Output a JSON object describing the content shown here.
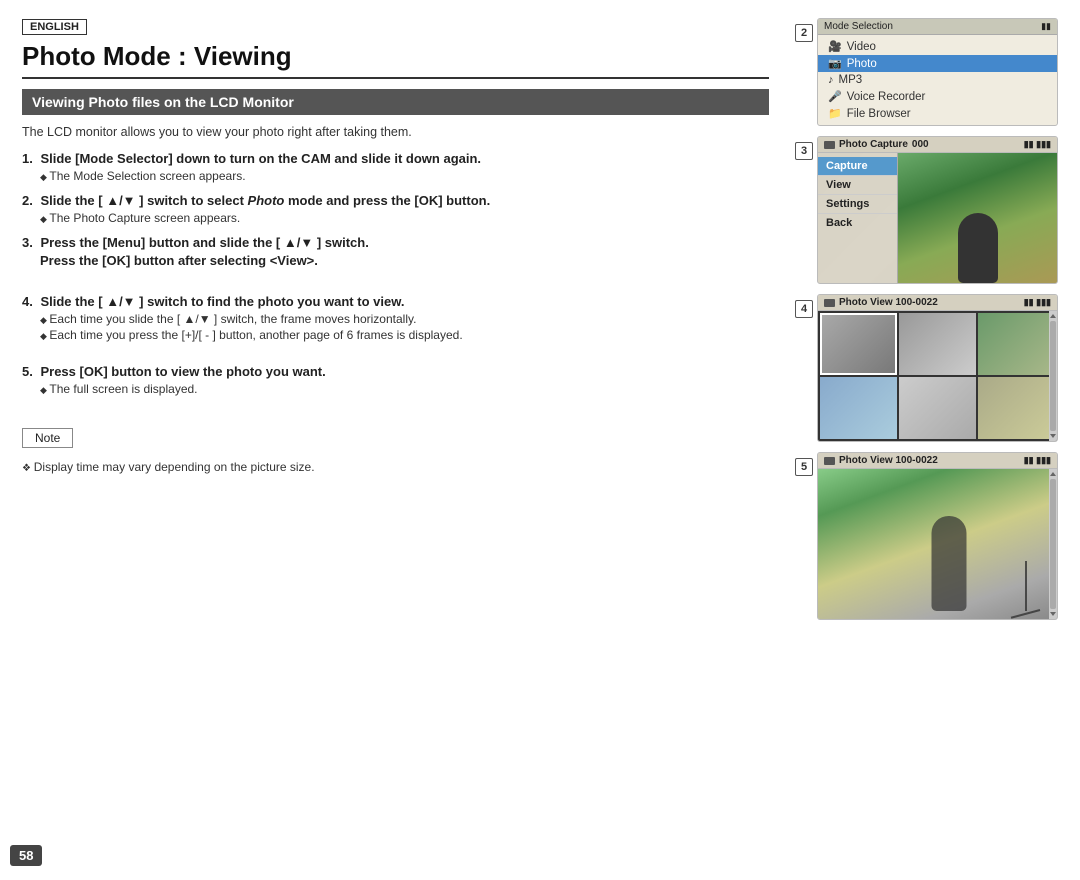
{
  "page": {
    "language_badge": "ENGLISH",
    "title": "Photo Mode : Viewing",
    "section_title": "Viewing Photo files on the LCD Monitor",
    "intro": "The LCD monitor allows you to view your photo right after taking them.",
    "page_number": "58"
  },
  "steps": [
    {
      "number": "1.",
      "main": "Slide [Mode Selector] down to turn on the CAM and slide it down again.",
      "subs": [
        "The Mode Selection screen appears."
      ]
    },
    {
      "number": "2.",
      "main_pre": "Slide the [ ▲/▼ ] switch to select ",
      "main_italic": "Photo",
      "main_post": " mode and press the [OK] button.",
      "subs": [
        "The Photo Capture screen appears."
      ]
    },
    {
      "number": "3.",
      "main_line1": "Press the [Menu] button and slide the [ ▲/▼ ] switch.",
      "main_line2": "Press the [OK] button after selecting <View>.",
      "subs": []
    },
    {
      "number": "4.",
      "main": "Slide the [ ▲/▼ ] switch to find the photo you want to view.",
      "subs": [
        "Each time you slide the [ ▲/▼ ] switch, the frame moves horizontally.",
        "Each time you press the [+]/[ - ] button, another page of 6 frames is displayed."
      ]
    },
    {
      "number": "5.",
      "main": "Press [OK] button to view the photo you want.",
      "subs": [
        "The full screen is displayed."
      ]
    }
  ],
  "note": {
    "label": "Note",
    "content": "Display time may vary depending on the picture size."
  },
  "screens": [
    {
      "step": "2",
      "title": "Mode Selection",
      "menu_items": [
        {
          "label": "Video",
          "icon": "🎥",
          "selected": false
        },
        {
          "label": "Photo",
          "icon": "📷",
          "selected": true
        },
        {
          "label": "MP3",
          "icon": "🎵",
          "selected": false
        },
        {
          "label": "Voice Recorder",
          "icon": "🎤",
          "selected": false
        },
        {
          "label": "File Browser",
          "icon": "📁",
          "selected": false
        }
      ]
    },
    {
      "step": "3",
      "title": "Photo Capture",
      "counter": "000",
      "menu_items": [
        {
          "label": "Capture",
          "selected": true
        },
        {
          "label": "View",
          "selected": false
        },
        {
          "label": "Settings",
          "selected": false
        },
        {
          "label": "Back",
          "selected": false
        }
      ]
    },
    {
      "step": "4",
      "title": "Photo View 100-0022"
    },
    {
      "step": "5",
      "title": "Photo View 100-0022"
    }
  ]
}
